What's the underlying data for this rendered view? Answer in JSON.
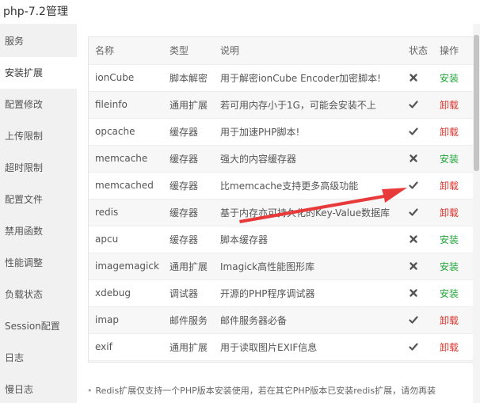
{
  "window": {
    "title": "php-7.2管理"
  },
  "sidebar": {
    "items": [
      {
        "label": "服务"
      },
      {
        "label": "安装扩展",
        "active": true
      },
      {
        "label": "配置修改"
      },
      {
        "label": "上传限制"
      },
      {
        "label": "超时限制"
      },
      {
        "label": "配置文件"
      },
      {
        "label": "禁用函数"
      },
      {
        "label": "性能调整"
      },
      {
        "label": "负载状态"
      },
      {
        "label": "Session配置"
      },
      {
        "label": "日志"
      },
      {
        "label": "慢日志"
      }
    ]
  },
  "table": {
    "headers": {
      "name": "名称",
      "type": "类型",
      "desc": "说明",
      "status": "状态",
      "op": "操作"
    },
    "rows": [
      {
        "name": "ionCube",
        "type": "脚本解密",
        "desc": "用于解密ionCube Encoder加密脚本!",
        "status": "cross",
        "op": "安装"
      },
      {
        "name": "fileinfo",
        "type": "通用扩展",
        "desc": "若可用内存小于1G，可能会安装不上",
        "status": "check",
        "op": "卸载"
      },
      {
        "name": "opcache",
        "type": "缓存器",
        "desc": "用于加速PHP脚本!",
        "status": "check",
        "op": "卸载"
      },
      {
        "name": "memcache",
        "type": "缓存器",
        "desc": "强大的内容缓存器",
        "status": "cross",
        "op": "安装"
      },
      {
        "name": "memcached",
        "type": "缓存器",
        "desc": "比memcache支持更多高级功能",
        "status": "check",
        "op": "卸载"
      },
      {
        "name": "redis",
        "type": "缓存器",
        "desc": "基于内存亦可持久化的Key-Value数据库",
        "status": "check",
        "op": "卸载"
      },
      {
        "name": "apcu",
        "type": "缓存器",
        "desc": "脚本缓存器",
        "status": "cross",
        "op": "安装"
      },
      {
        "name": "imagemagick",
        "type": "通用扩展",
        "desc": "Imagick高性能图形库",
        "status": "cross",
        "op": "安装"
      },
      {
        "name": "xdebug",
        "type": "调试器",
        "desc": "开源的PHP程序调试器",
        "status": "cross",
        "op": "安装"
      },
      {
        "name": "imap",
        "type": "邮件服务",
        "desc": "邮件服务器必备",
        "status": "check",
        "op": "卸载"
      },
      {
        "name": "exif",
        "type": "通用扩展",
        "desc": "用于读取图片EXIF信息",
        "status": "check",
        "op": "卸载"
      },
      {
        "name": "",
        "type": "",
        "desc": "",
        "status": "",
        "op": ""
      }
    ]
  },
  "note": {
    "text": "Redis扩展仅支持一个PHP版本安装使用，若在其它PHP版本已安装redis扩展，请勿再装"
  },
  "colors": {
    "install": "#20a53a",
    "uninstall": "#d9342b",
    "icon": "#555555",
    "arrow": "#e83a3a"
  },
  "icons": {
    "check": "check-icon",
    "cross": "cross-icon",
    "annotation": "red-arrow"
  }
}
